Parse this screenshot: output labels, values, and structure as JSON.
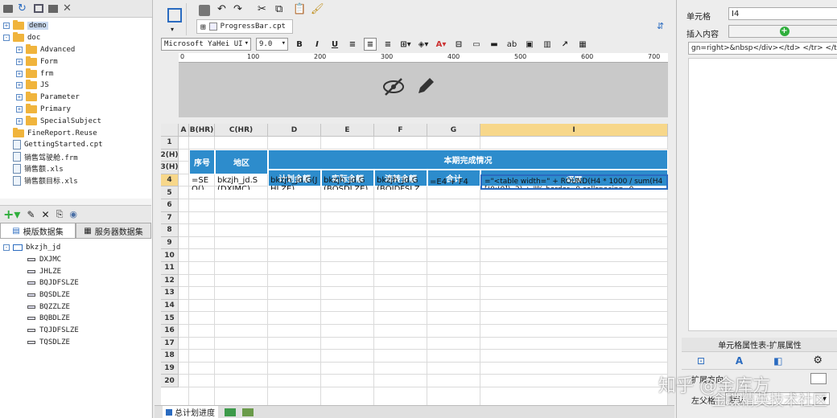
{
  "left_tree": [
    {
      "label": "demo",
      "type": "folder",
      "exp": "+",
      "indent": 0,
      "selected": true
    },
    {
      "label": "doc",
      "type": "folder",
      "exp": "-",
      "indent": 0
    },
    {
      "label": "Advanced",
      "type": "folder",
      "exp": "+",
      "indent": 1
    },
    {
      "label": "Form",
      "type": "folder",
      "exp": "+",
      "indent": 1
    },
    {
      "label": "frm",
      "type": "folder",
      "exp": "+",
      "indent": 1
    },
    {
      "label": "JS",
      "type": "folder",
      "exp": "+",
      "indent": 1
    },
    {
      "label": "Parameter",
      "type": "folder",
      "exp": "+",
      "indent": 1
    },
    {
      "label": "Primary",
      "type": "folder",
      "exp": "+",
      "indent": 1
    },
    {
      "label": "SpecialSubject",
      "type": "folder",
      "exp": "+",
      "indent": 1
    },
    {
      "label": "FineReport.Reuse",
      "type": "folder",
      "exp": "",
      "indent": 0
    },
    {
      "label": "GettingStarted.cpt",
      "type": "file",
      "exp": "",
      "indent": 0
    },
    {
      "label": "销售驾驶舱.frm",
      "type": "file",
      "exp": "",
      "indent": 0
    },
    {
      "label": "销售额.xls",
      "type": "file",
      "exp": "",
      "indent": 0
    },
    {
      "label": "销售额目标.xls",
      "type": "file",
      "exp": "",
      "indent": 0
    }
  ],
  "ds_tabs": {
    "template": "模版数据集",
    "server": "服务器数据集"
  },
  "dataset": {
    "name": "bkzjh_jd",
    "columns": [
      "DXJMC",
      "JHLZE",
      "BQJDFSLZE",
      "BQSDLZE",
      "BQZZLZE",
      "BQBDLZE",
      "TQJDFSLZE",
      "TQSDLZE"
    ]
  },
  "file_tab": "ProgressBar.cpt",
  "font": {
    "name": "Microsoft YaHei UI",
    "size": "9.0"
  },
  "ruler_ticks": [
    "0",
    "100",
    "200",
    "300",
    "400",
    "500",
    "600",
    "700"
  ],
  "col_headers": [
    "A",
    "B(HR)",
    "C(HR)",
    "D",
    "E",
    "F",
    "G",
    "I"
  ],
  "row_headers": [
    "1",
    "2(H)",
    "3(H)",
    "4",
    "5",
    "6",
    "7",
    "8",
    "9",
    "10",
    "11",
    "12",
    "13",
    "14",
    "15",
    "16",
    "17",
    "18",
    "19",
    "20"
  ],
  "table_header": {
    "seq": "序号",
    "region": "地区",
    "group": "本期完成情况",
    "plan": "计划金额",
    "actual": "实际金额",
    "flow": "流转金额",
    "total": "合计",
    "progress": "进度"
  },
  "row4": {
    "b": "=SEQ()",
    "c": "bkzjh_jd.S(DXJMC)",
    "d": "bkzjh_jd.G(JHLZE)",
    "e": "bkzjh_jd.G(BQSDLZE)",
    "f": "bkzjh_jd.G(BQJDFSLZE)",
    "g": "=E4 + F4",
    "i": "=\"<table width=\" + ROUND(H4 * 1000 / sum(H4[!0;!0]), 2) + \"% border=0 cellspacing=0"
  },
  "sheet_tab": "总计划进度",
  "right": {
    "cell_label": "单元格",
    "cell_value": "I4",
    "insert_label": "插入内容",
    "content": "gn=right>&nbsp</div></td> </tr> </table>\"",
    "panel_title": "单元格属性表-扩展属性",
    "expand_label": "扩展方向",
    "parent_label": "左父格",
    "parent_value": "默认"
  },
  "watermark": "知乎 @金库方",
  "watermark2": "金蝶精英技术社区",
  "colors": {
    "header_blue": "#2d8ccc",
    "selected_header": "#f7d78a",
    "add_green": "#2fae3c"
  }
}
